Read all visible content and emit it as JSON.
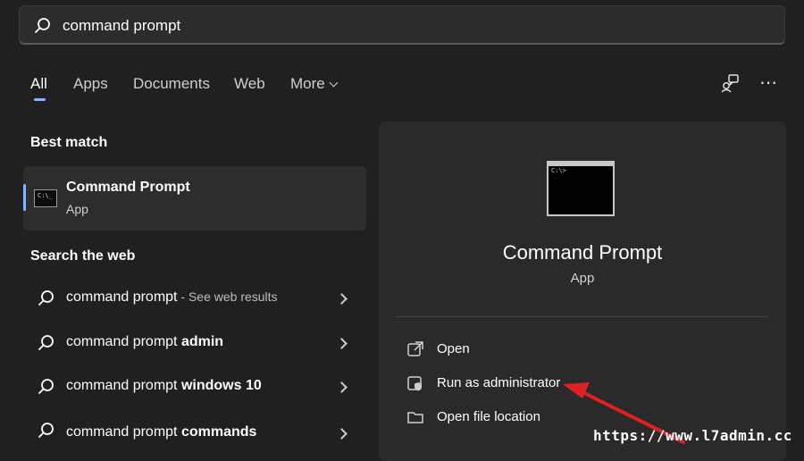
{
  "search": {
    "query": "command prompt"
  },
  "tabs": [
    {
      "label": "All",
      "active": true
    },
    {
      "label": "Apps"
    },
    {
      "label": "Documents"
    },
    {
      "label": "Web"
    },
    {
      "label": "More"
    }
  ],
  "toolbar": {
    "icons": [
      "account-switch-icon",
      "more-options-icon"
    ],
    "more_options_glyph": "⋯"
  },
  "best_match": {
    "section_title": "Best match",
    "name": "Command Prompt",
    "type": "App",
    "icon": "command-prompt-icon"
  },
  "search_web": {
    "section_title": "Search the web",
    "items": [
      {
        "prefix": "command prompt",
        "bold": "",
        "suffix": " - See web results"
      },
      {
        "prefix": "command prompt ",
        "bold": "admin",
        "suffix": ""
      },
      {
        "prefix": "command prompt ",
        "bold": "windows 10",
        "suffix": ""
      },
      {
        "prefix": "command prompt ",
        "bold": "commands",
        "suffix": ""
      }
    ]
  },
  "details": {
    "name": "Command Prompt",
    "type": "App",
    "actions": [
      {
        "label": "Open",
        "icon": "open-external-icon"
      },
      {
        "label": "Run as administrator",
        "icon": "shield-admin-icon"
      },
      {
        "label": "Open file location",
        "icon": "folder-icon"
      }
    ]
  },
  "watermark": {
    "text": "https://www.l7admin.cc"
  },
  "colors": {
    "accent": "#8ab4f8",
    "annotation_arrow": "#e02020",
    "background": "#202020",
    "panel": "#2a2a2a"
  }
}
